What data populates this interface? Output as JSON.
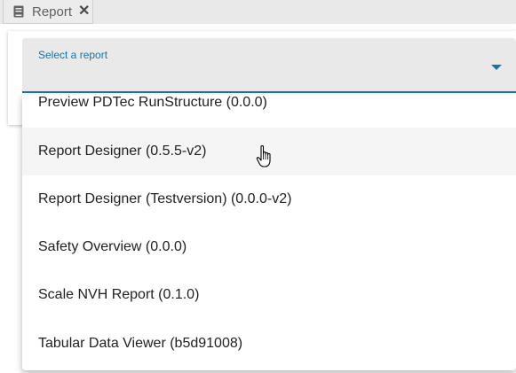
{
  "tab": {
    "label": "Report",
    "icon": "book-icon",
    "close_glyph": "✕"
  },
  "select": {
    "label": "Select a report",
    "value": ""
  },
  "options": [
    "Preview PDTec RunStructure (0.0.0)",
    "Report Designer (0.5.5-v2)",
    "Report Designer (Testversion) (0.0.0-v2)",
    "Safety Overview (0.0.0)",
    "Scale NVH Report (0.1.0)",
    "Tabular Data Viewer (b5d91008)"
  ],
  "hovered_option": "Report Designer (0.5.5-v2)",
  "colors": {
    "accent": "#1a73a8",
    "field_bg": "#e9e9e9",
    "hover_bg": "#f5f5f5"
  }
}
